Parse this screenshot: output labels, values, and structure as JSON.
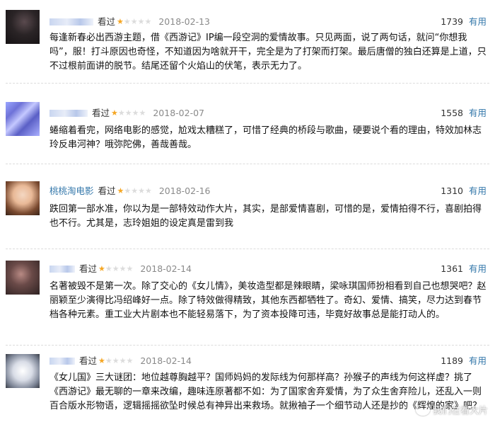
{
  "reviews": [
    {
      "user": "",
      "status": "看过",
      "rating_stars": 1,
      "date": "2018-02-13",
      "votes": "1739",
      "useful_label": "有用",
      "content": "每逢新春必出西游主题，借《西游记》IP编一段空洞的爱情故事。只见两面，说了两句话，就问“你想我吗”，服！打斗原因也奇怪，不知道因为啥就开干，完全是为了打架而打架。最后唐僧的独白还算是上道，只不过根前面讲的脱节。结尾还留个火焰山的伏笔，表示无力了。"
    },
    {
      "user": "",
      "status": "看过",
      "rating_stars": 1,
      "date": "2018-02-07",
      "votes": "1558",
      "useful_label": "有用",
      "content": "蜷缩着看完，网络电影的感觉，尬戏太糟糕了，可惜了经典的桥段与歌曲，硬要说个看的理由，特效加林志玲反串河神？哦弥陀佛，善哉善哉。"
    },
    {
      "user": "桃桃淘电影",
      "status": "看过",
      "rating_stars": 1,
      "date": "2018-02-16",
      "votes": "1310",
      "useful_label": "有用",
      "content": "跌回第一部水准，你以为是一部特效动作大片，其实，是部爱情喜剧，可惜的是，爱情拍得不行，喜剧拍得也不行。尤其是，志玲姐姐的设定真是雷到我"
    },
    {
      "user": "",
      "status": "看过",
      "rating_stars": 1,
      "date": "2018-02-14",
      "votes": "1361",
      "useful_label": "有用",
      "content": "名著被毁不是第一次。除了交心的《女儿情》，美妆造型都是辣眼睛，梁咏琪国师扮相看到自己也想哭吧？赵丽颖至少演得比冯绍峰好一点。除了特效做得精致，其他东西都牺牲了。奇幻、爱情、搞笑，尽力达到春节档各种元素。重工业大片剧本也不能轻易落下，为了资本投降可违，毕竟好故事总是能打动人的。"
    },
    {
      "user": "",
      "status": "看过",
      "rating_stars": 1,
      "date": "2018-02-14",
      "votes": "1189",
      "useful_label": "有用",
      "content": "《女儿国》三大谜团：地位越尊胸越平？国师妈妈的发际线为何那样高？孙猴子的声线为何这样虚？挑了《西游记》最无聊的一章来改编，趣味连原著都不如：为了国家舍弃爱情，为了众生舍弃险儿，还乱入一则百合版水形物语，逻辑摇摇欲坠时候总有神异出来救场。就揪袖子一个细节动人还是抄的《辉煌的家》吧？"
    }
  ],
  "watermark": "我们在看大片",
  "colors": {
    "link": "#3377aa",
    "star": "#f5a623",
    "date": "#8a8a8a"
  }
}
